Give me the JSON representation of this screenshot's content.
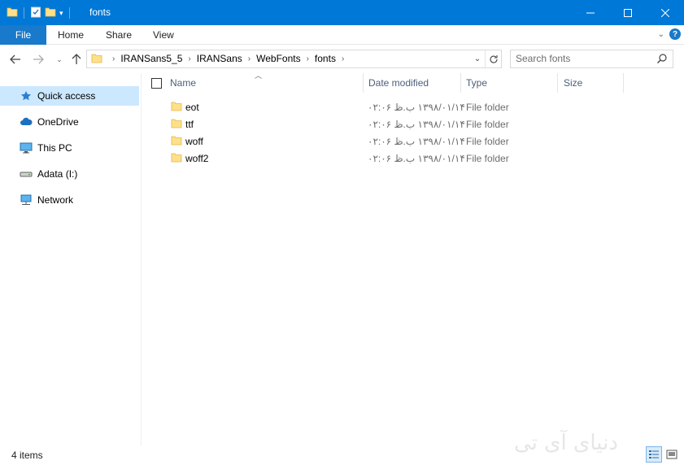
{
  "window": {
    "title": "fonts",
    "accent_color": "#0078d7",
    "controls": [
      "minimize-icon",
      "maximize-icon",
      "close-icon"
    ]
  },
  "ribbon": {
    "tabs": [
      "File",
      "Home",
      "Share",
      "View"
    ],
    "file_tab_color": "#1979ca",
    "help_label": "?"
  },
  "address": {
    "crumbs": [
      "IRANSans5_5",
      "IRANSans",
      "WebFonts",
      "fonts"
    ],
    "search_placeholder": "Search fonts"
  },
  "nav": {
    "items": [
      {
        "label": "Quick access",
        "icon": "star-icon",
        "selected": true
      },
      {
        "label": "OneDrive",
        "icon": "cloud-icon",
        "selected": false
      },
      {
        "label": "This PC",
        "icon": "monitor-icon",
        "selected": false
      },
      {
        "label": "Adata (I:)",
        "icon": "drive-icon",
        "selected": false
      },
      {
        "label": "Network",
        "icon": "network-icon",
        "selected": false
      }
    ]
  },
  "columns": {
    "name": "Name",
    "date": "Date modified",
    "type": "Type",
    "size": "Size"
  },
  "files": [
    {
      "name": "eot",
      "date": "۱۳۹۸/۰۱/۱۴ ب.ظ ۰۲:۰۶",
      "type": "File folder"
    },
    {
      "name": "ttf",
      "date": "۱۳۹۸/۰۱/۱۴ ب.ظ ۰۲:۰۶",
      "type": "File folder"
    },
    {
      "name": "woff",
      "date": "۱۳۹۸/۰۱/۱۴ ب.ظ ۰۲:۰۶",
      "type": "File folder"
    },
    {
      "name": "woff2",
      "date": "۱۳۹۸/۰۱/۱۴ ب.ظ ۰۲:۰۶",
      "type": "File folder"
    }
  ],
  "status": {
    "items_count": "4 items",
    "watermark": "دنیای آی تی"
  }
}
